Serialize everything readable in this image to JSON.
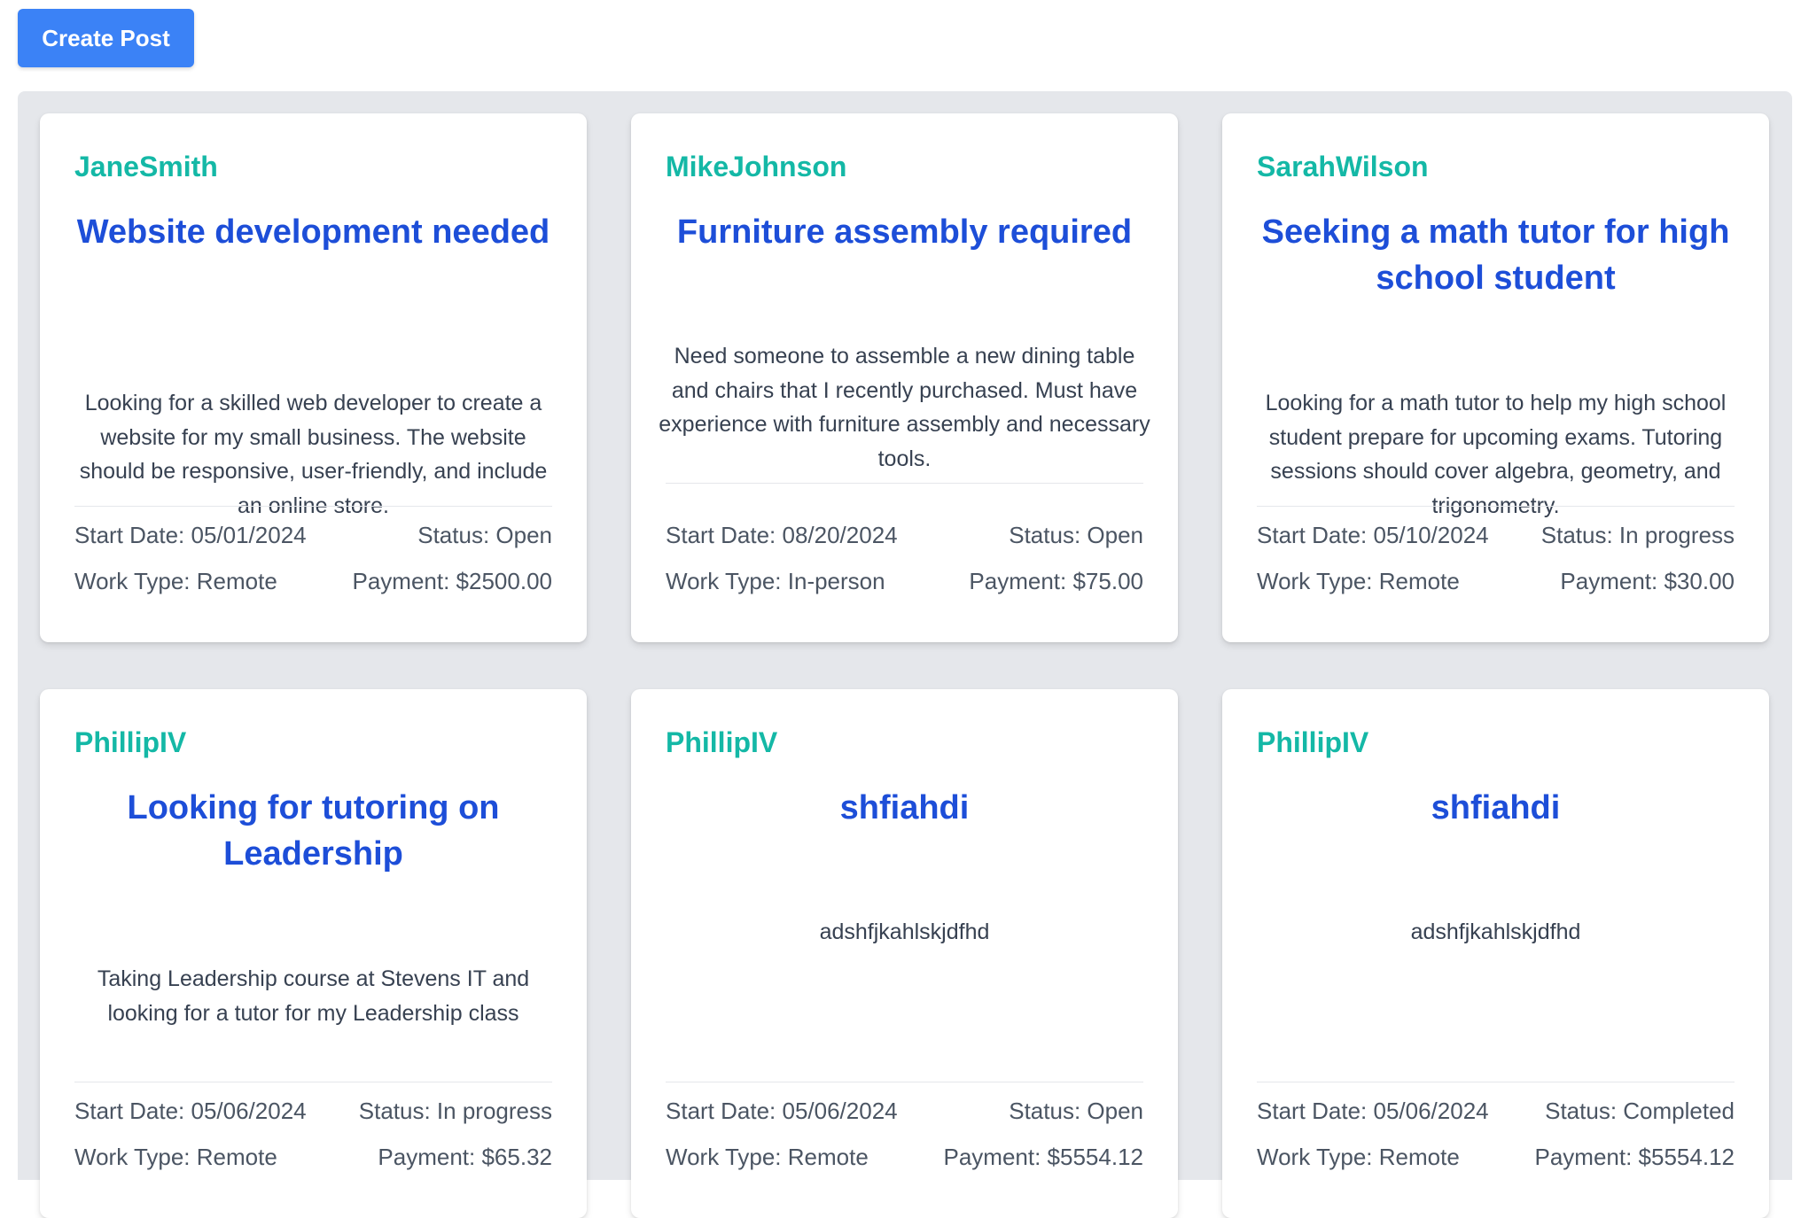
{
  "toolbar": {
    "create_label": "Create Post"
  },
  "labels": {
    "start_date": "Start Date:",
    "status": "Status:",
    "work_type": "Work Type:",
    "payment": "Payment:"
  },
  "posts": [
    {
      "username": "JaneSmith",
      "title": "Website development needed",
      "description": "Looking for a skilled web developer to create a website for my small business. The website should be responsive, user-friendly, and include an online store.",
      "start_date": "Start Date: 05/01/2024",
      "status": "Status: Open",
      "work_type": "Work Type: Remote",
      "payment": "Payment: $2500.00"
    },
    {
      "username": "MikeJohnson",
      "title": "Furniture assembly required",
      "description": "Need someone to assemble a new dining table and chairs that I recently purchased. Must have experience with furniture assembly and necessary tools.",
      "start_date": "Start Date: 08/20/2024",
      "status": "Status: Open",
      "work_type": "Work Type: In-person",
      "payment": "Payment: $75.00"
    },
    {
      "username": "SarahWilson",
      "title": "Seeking a math tutor for high school student",
      "description": "Looking for a math tutor to help my high school student prepare for upcoming exams. Tutoring sessions should cover algebra, geometry, and trigonometry.",
      "start_date": "Start Date: 05/10/2024",
      "status": "Status: In progress",
      "work_type": "Work Type: Remote",
      "payment": "Payment: $30.00"
    },
    {
      "username": "PhillipIV",
      "title": "Looking for tutoring on Leadership",
      "description": "Taking Leadership course at Stevens IT and looking for a tutor for my Leadership class",
      "start_date": "Start Date: 05/06/2024",
      "status": "Status: In progress",
      "work_type": "Work Type: Remote",
      "payment": "Payment: $65.32"
    },
    {
      "username": "PhillipIV",
      "title": "shfiahdi",
      "description": "adshfjkahlskjdfhd",
      "start_date": "Start Date: 05/06/2024",
      "status": "Status: Open",
      "work_type": "Work Type: Remote",
      "payment": "Payment: $5554.12"
    },
    {
      "username": "PhillipIV",
      "title": "shfiahdi",
      "description": "adshfjkahlskjdfhd",
      "start_date": "Start Date: 05/06/2024",
      "status": "Status: Completed",
      "work_type": "Work Type: Remote",
      "payment": "Payment: $5554.12"
    }
  ],
  "colors": {
    "button": "#3b82f6",
    "username": "#14b8a6",
    "title": "#1d4ed8",
    "panel": "#e5e7eb"
  }
}
